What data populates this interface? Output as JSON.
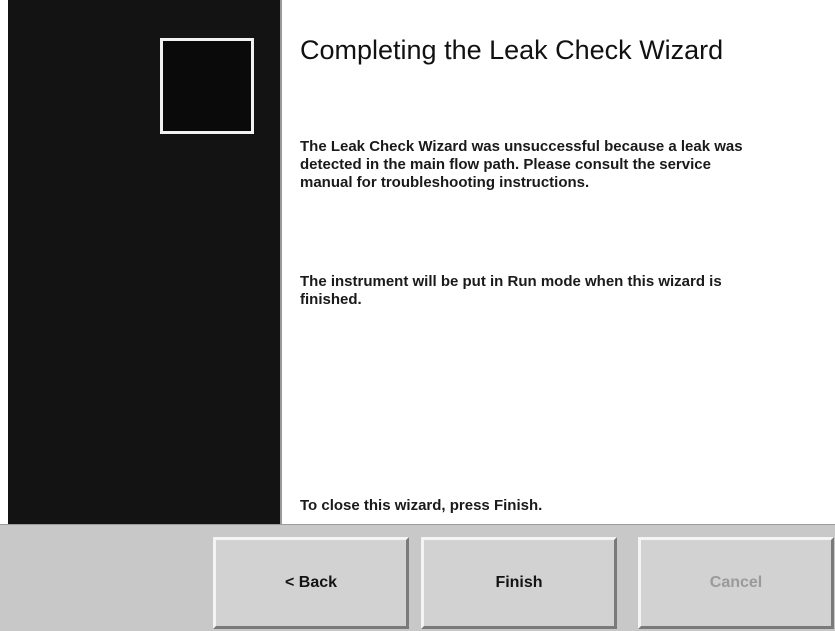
{
  "wizard": {
    "title": "Completing the Leak Check Wizard",
    "message": "The Leak Check Wizard was unsuccessful because a leak was detected in the main flow path. Please consult the service manual for troubleshooting instructions.",
    "note": "The instrument will be put in Run mode when this wizard is finished.",
    "footer": "To close this wizard, press Finish."
  },
  "buttons": {
    "back_label": "< Back",
    "finish_label": "Finish",
    "cancel_label": "Cancel",
    "cancel_enabled": false
  },
  "colors": {
    "sidebar": "#131313",
    "button_face": "#d2d2d2",
    "bar_background": "#c8c8c8",
    "disabled_text": "#9a9a9a"
  }
}
